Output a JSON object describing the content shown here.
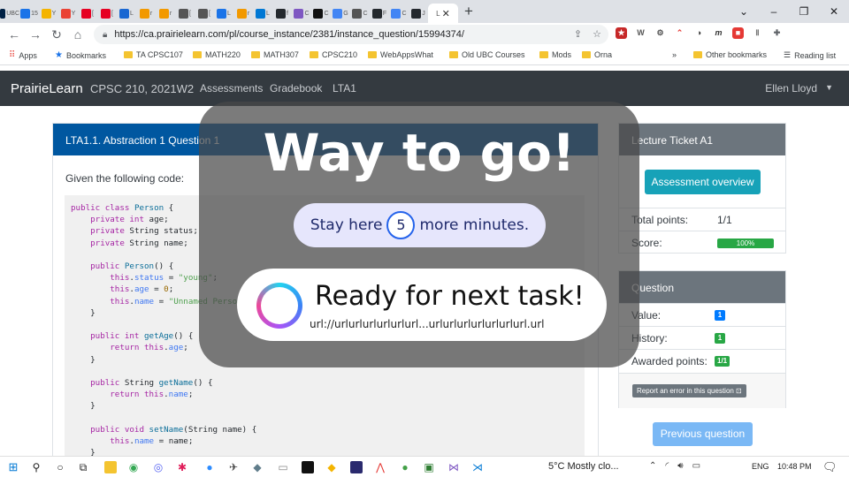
{
  "browser": {
    "tabs": [
      {
        "icon": "ubc-icon",
        "color": "#002145",
        "text": "UBC"
      },
      {
        "icon": "calendar-icon",
        "color": "#1a73e8",
        "text": "15"
      },
      {
        "icon": "keep-icon",
        "color": "#f4b400",
        "text": "Y"
      },
      {
        "icon": "gmail-icon",
        "color": "#ea4335",
        "text": "Y"
      },
      {
        "icon": "pinterest-icon",
        "color": "#e60023",
        "text": "["
      },
      {
        "icon": "pinterest-icon",
        "color": "#e60023",
        "text": "["
      },
      {
        "icon": "docs-icon",
        "color": "#1967d2",
        "text": "L"
      },
      {
        "icon": "notion-icon",
        "color": "#f29900",
        "text": "r"
      },
      {
        "icon": "notion-icon",
        "color": "#f29900",
        "text": "r"
      },
      {
        "icon": "circle-icon",
        "color": "#555555",
        "text": "["
      },
      {
        "icon": "circle-icon",
        "color": "#555555",
        "text": "["
      },
      {
        "icon": "edge-icon",
        "color": "#1a73e8",
        "text": "L"
      },
      {
        "icon": "notion-icon",
        "color": "#f29900",
        "text": "r"
      },
      {
        "icon": "windows-icon",
        "color": "#0078d4",
        "text": "L"
      },
      {
        "icon": "github-icon",
        "color": "#24292e",
        "text": "f"
      },
      {
        "icon": "purple-icon",
        "color": "#7e57c2",
        "text": "C"
      },
      {
        "icon": "black-icon",
        "color": "#111111",
        "text": "C"
      },
      {
        "icon": "google-icon",
        "color": "#4285f4",
        "text": "G"
      },
      {
        "icon": "circle-icon",
        "color": "#555555",
        "text": "C"
      },
      {
        "icon": "github-icon",
        "color": "#24292e",
        "text": "F"
      },
      {
        "icon": "google-icon",
        "color": "#4285f4",
        "text": "C"
      },
      {
        "icon": "github-icon",
        "color": "#24292e",
        "text": "J"
      }
    ],
    "active_tab": {
      "text": "L",
      "close": "✕"
    },
    "new_tab": "+",
    "window_controls": [
      "⌄",
      "–",
      "❐",
      "✕"
    ],
    "nav": {
      "back": "←",
      "forward": "→",
      "reload": "↻",
      "home": "⌂"
    },
    "url": "https://ca.prairielearn.com/pl/course_instance/2381/instance_question/15994374/",
    "bookmarks": {
      "apps": "Apps",
      "bookmarks": "Bookmarks",
      "folders": [
        "TA CPSC107",
        "MATH220",
        "MATH307",
        "CPSC210",
        "WebAppsWhat",
        "Old UBC Courses",
        "Mods",
        "Orna"
      ],
      "overflow": "»",
      "other": "Other bookmarks",
      "reading_list": "Reading list"
    }
  },
  "navbar": {
    "brand": "PrairieLearn",
    "course": "CPSC 210, 2021W2",
    "links": [
      "Assessments",
      "Gradebook",
      "LTA1"
    ],
    "user": "Ellen Lloyd"
  },
  "question": {
    "title": "LTA1.1. Abstraction 1 Question 1",
    "intro": "Given the following code:"
  },
  "lecture_ticket": {
    "title": "Lecture Ticket A1",
    "overview_button": "Assessment overview",
    "total_points_label": "Total points:",
    "total_points_value": "1/1",
    "score_label": "Score:",
    "score_value": "100%",
    "score_fraction": 1.0
  },
  "question_panel": {
    "title": "Question",
    "value_label": "Value:",
    "value_badge": "1",
    "history_label": "History:",
    "history_badge": "1",
    "awarded_label": "Awarded points:",
    "awarded_badge": "1/1",
    "report_button": "Report an error in this question ⊡"
  },
  "previous_button": "Previous question",
  "overlay": {
    "title": "Way to go!",
    "stay_prefix": "Stay here",
    "stay_count": "5",
    "stay_suffix": "more minutes.",
    "ready_title": "Ready for next task!",
    "ready_url": "url://urlurlurlurlurlurl...urlurlurlurlurlurlurl.url"
  },
  "taskbar": {
    "weather": "5°C  Mostly clo...",
    "language": "ENG",
    "time": "10:48 PM"
  }
}
